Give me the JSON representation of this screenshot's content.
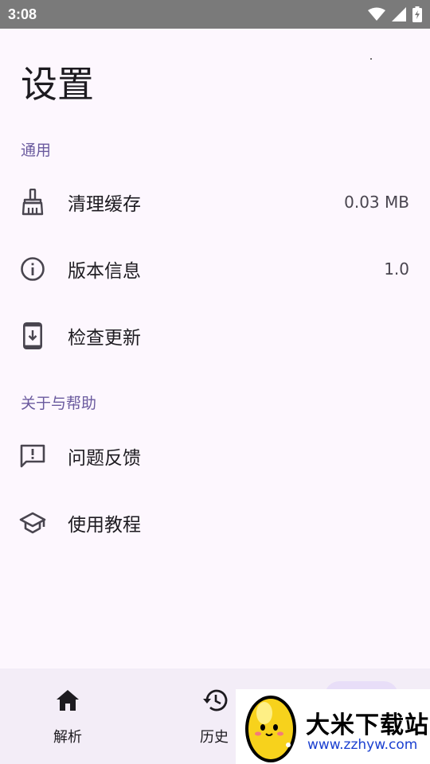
{
  "status_bar": {
    "time": "3:08"
  },
  "page": {
    "title": "设置"
  },
  "sections": {
    "general": {
      "header": "通用",
      "items": [
        {
          "label": "清理缓存",
          "value": "0.03 MB",
          "icon": "broom-icon"
        },
        {
          "label": "版本信息",
          "value": "1.0",
          "icon": "info-icon"
        },
        {
          "label": "检查更新",
          "value": "",
          "icon": "phone-download-icon"
        }
      ]
    },
    "about": {
      "header": "关于与帮助",
      "items": [
        {
          "label": "问题反馈",
          "icon": "feedback-icon"
        },
        {
          "label": "使用教程",
          "icon": "school-icon"
        }
      ]
    }
  },
  "bottom_nav": {
    "items": [
      {
        "label": "解析",
        "icon": "home-icon"
      },
      {
        "label": "历史",
        "icon": "history-icon"
      }
    ]
  },
  "watermark": {
    "title": "大米下载站",
    "url": "www.zzhyw.com"
  },
  "colors": {
    "accent": "#6a5a9e",
    "background": "#fdf7fe",
    "nav_background": "#f3edf7",
    "status_bar": "#7a7a7a"
  }
}
